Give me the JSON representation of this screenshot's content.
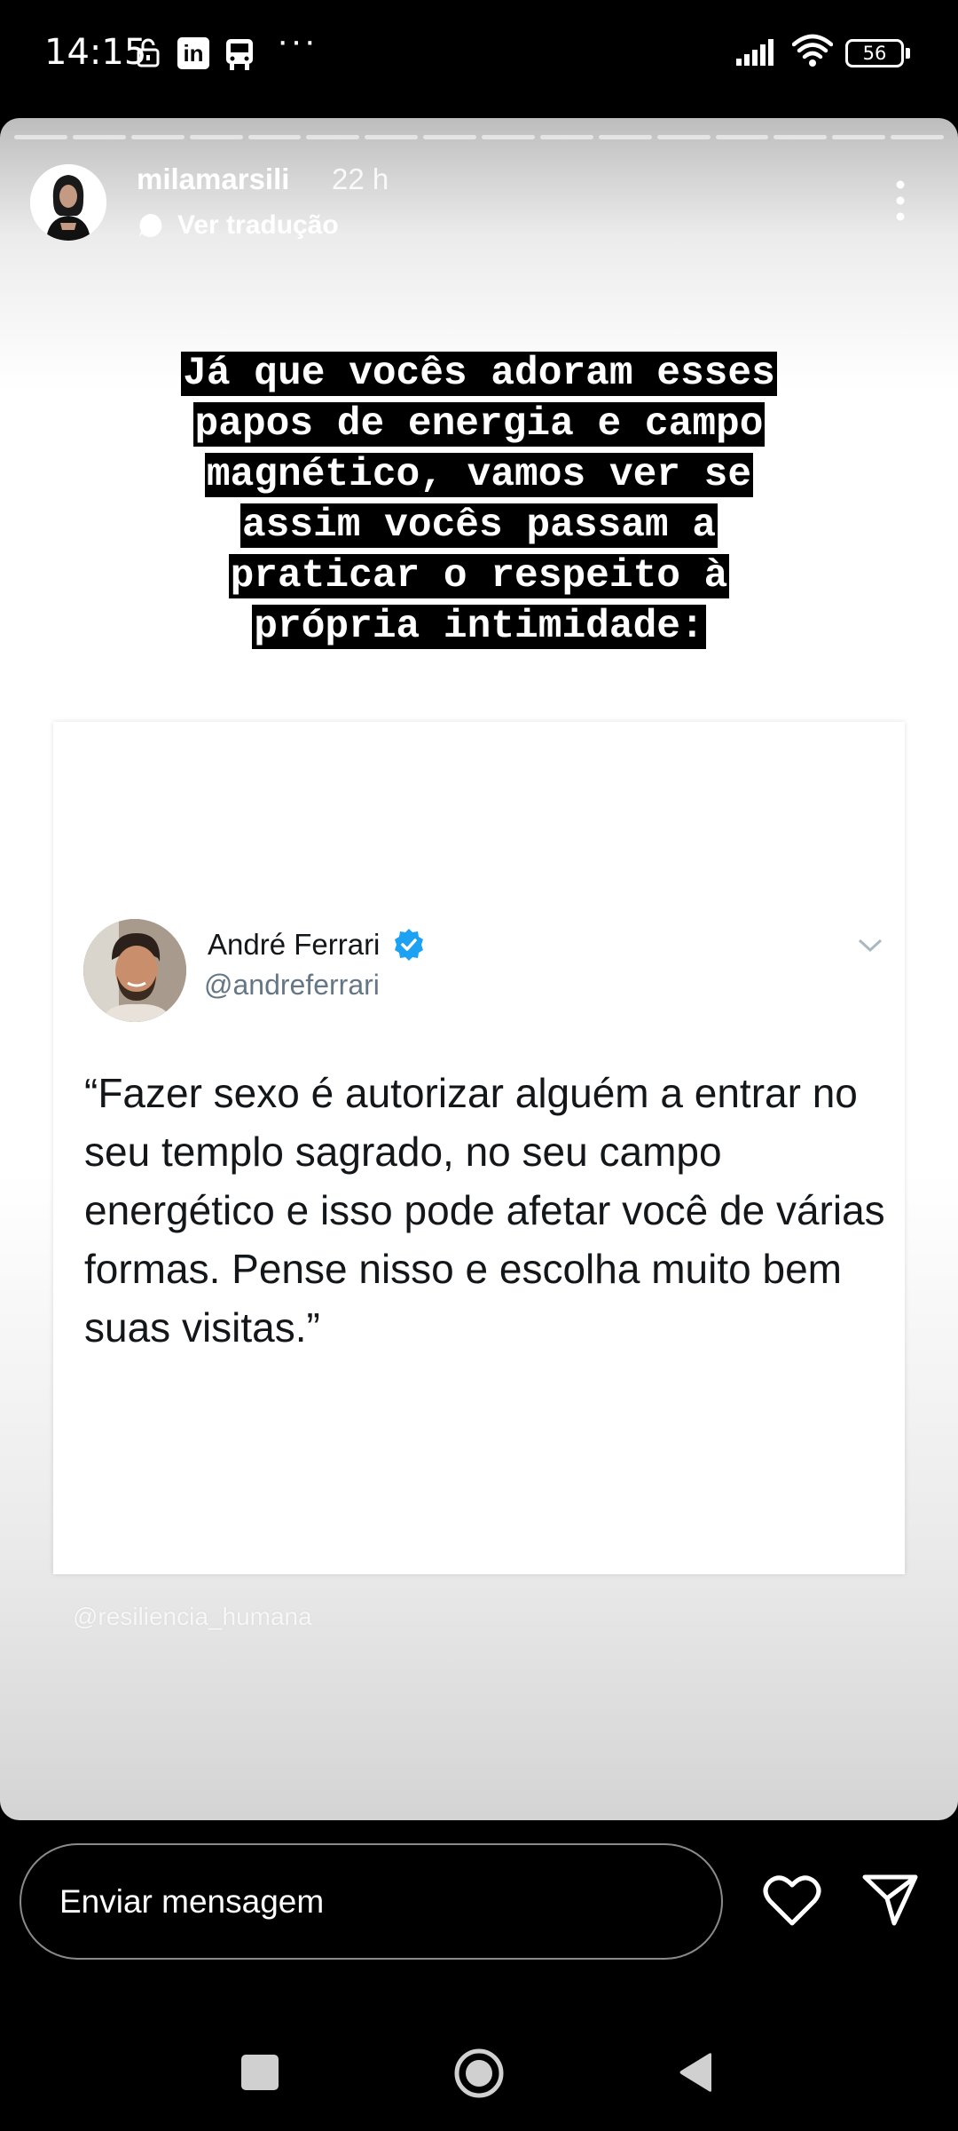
{
  "status_bar": {
    "time": "14:15",
    "more": "···",
    "battery": "56",
    "linkedin": "in"
  },
  "story": {
    "progress_segments": 16,
    "username": "milamarsili",
    "time_ago": "22 h",
    "translate_label": "Ver tradução",
    "caption_lines": [
      "Já que vocês adoram esses",
      "papos de energia e campo",
      "magnético, vamos ver se",
      "assim vocês passam a",
      "praticar o respeito à",
      "própria intimidade:"
    ],
    "tweet": {
      "name": "André Ferrari",
      "handle": "@andreferrari",
      "text": "“Fazer sexo é autorizar alguém a entrar no seu templo sagrado, no seu campo energético e isso pode afetar você de várias formas. Pense nisso e escolha muito bem suas visitas.”"
    },
    "watermark": "@resiliencia_humana"
  },
  "reply_bar": {
    "input_placeholder": "Enviar mensagem"
  },
  "colors": {
    "verified": "#1da1f2",
    "caption_bg": "#000000",
    "tweet_text": "#14171a",
    "handle": "#657786"
  },
  "icons": [
    "lock-icon",
    "linkedin-icon",
    "bus-icon",
    "signal-icon",
    "wifi-icon",
    "battery-icon",
    "translate-icon",
    "more-vertical-icon",
    "verified-icon",
    "chevron-down-icon",
    "heart-icon",
    "send-icon",
    "nav-recents-icon",
    "nav-home-icon",
    "nav-back-icon"
  ]
}
